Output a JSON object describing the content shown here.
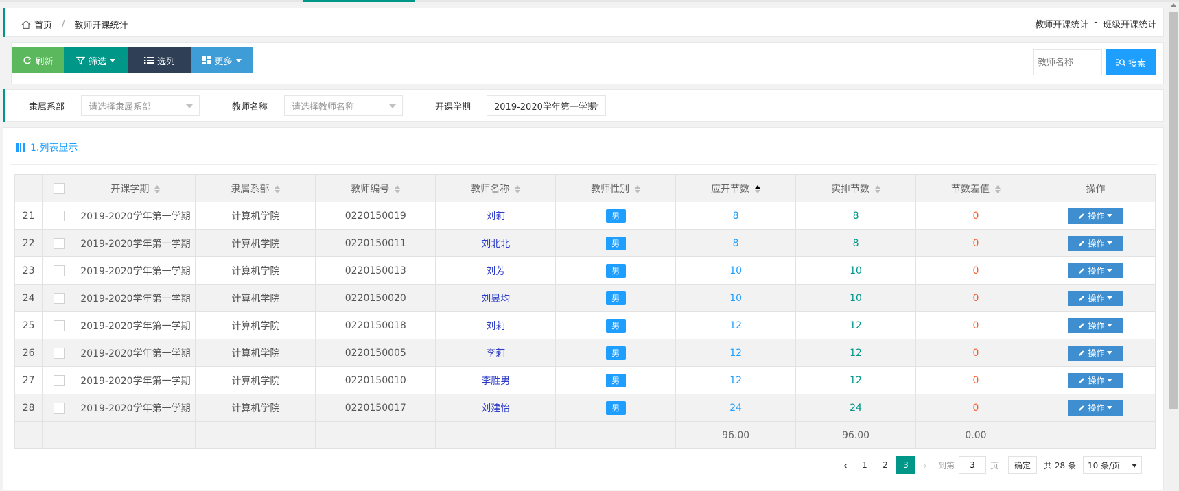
{
  "breadcrumb": {
    "home": "首页",
    "separator": "/",
    "current": "教师开课统计"
  },
  "header_links": {
    "teacher_stats": "教师开课统计",
    "sep": "-",
    "class_stats": "班级开课统计"
  },
  "toolbar": {
    "refresh": "刷新",
    "filter": "筛选",
    "columns": "选列",
    "more": "更多",
    "search_placeholder": "教师名称",
    "search": "搜索"
  },
  "filters": {
    "dept_label": "隶属系部",
    "dept_placeholder": "请选择隶属系部",
    "teacher_label": "教师名称",
    "teacher_placeholder": "请选择教师名称",
    "term_label": "开课学期",
    "term_value": "2019-2020学年第一学期"
  },
  "panel": {
    "title": "1.列表显示"
  },
  "table": {
    "headers": [
      "开课学期",
      "隶属系部",
      "教师编号",
      "教师名称",
      "教师性别",
      "应开节数",
      "实排节数",
      "节数差值",
      "操作"
    ],
    "rows": [
      {
        "idx": "21",
        "term": "2019-2020学年第一学期",
        "dept": "计算机学院",
        "code": "0220150019",
        "name": "刘莉",
        "gender": "男",
        "planned": "8",
        "actual": "8",
        "diff": "0",
        "op": "操作"
      },
      {
        "idx": "22",
        "term": "2019-2020学年第一学期",
        "dept": "计算机学院",
        "code": "0220150011",
        "name": "刘北北",
        "gender": "男",
        "planned": "8",
        "actual": "8",
        "diff": "0",
        "op": "操作"
      },
      {
        "idx": "23",
        "term": "2019-2020学年第一学期",
        "dept": "计算机学院",
        "code": "0220150013",
        "name": "刘芳",
        "gender": "男",
        "planned": "10",
        "actual": "10",
        "diff": "0",
        "op": "操作"
      },
      {
        "idx": "24",
        "term": "2019-2020学年第一学期",
        "dept": "计算机学院",
        "code": "0220150020",
        "name": "刘昱均",
        "gender": "男",
        "planned": "10",
        "actual": "10",
        "diff": "0",
        "op": "操作"
      },
      {
        "idx": "25",
        "term": "2019-2020学年第一学期",
        "dept": "计算机学院",
        "code": "0220150018",
        "name": "刘莉",
        "gender": "男",
        "planned": "12",
        "actual": "12",
        "diff": "0",
        "op": "操作"
      },
      {
        "idx": "26",
        "term": "2019-2020学年第一学期",
        "dept": "计算机学院",
        "code": "0220150005",
        "name": "李莉",
        "gender": "男",
        "planned": "12",
        "actual": "12",
        "diff": "0",
        "op": "操作"
      },
      {
        "idx": "27",
        "term": "2019-2020学年第一学期",
        "dept": "计算机学院",
        "code": "0220150010",
        "name": "李胜男",
        "gender": "男",
        "planned": "12",
        "actual": "12",
        "diff": "0",
        "op": "操作"
      },
      {
        "idx": "28",
        "term": "2019-2020学年第一学期",
        "dept": "计算机学院",
        "code": "0220150017",
        "name": "刘建怡",
        "gender": "男",
        "planned": "24",
        "actual": "24",
        "diff": "0",
        "op": "操作"
      }
    ],
    "totals": {
      "planned": "96.00",
      "actual": "96.00",
      "diff": "0.00"
    }
  },
  "pager": {
    "pages": [
      "1",
      "2",
      "3"
    ],
    "current": "3",
    "goto_label": "到第",
    "goto_value": "3",
    "page_unit": "页",
    "ok": "确定",
    "total": "共 28 条",
    "page_size": "10 条/页"
  },
  "colors": {
    "accent": "#009688",
    "blue": "#1e9fff",
    "refresh": "#5cb85c",
    "columns": "#2f4056",
    "more": "#3e9cd6",
    "danger": "#ff5722"
  }
}
